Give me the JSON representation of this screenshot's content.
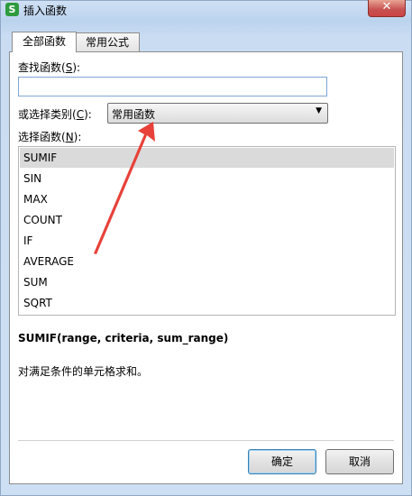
{
  "window": {
    "app_icon_letter": "S",
    "title": "插入函数",
    "close_glyph": "✕"
  },
  "tabs": [
    {
      "label": "全部函数"
    },
    {
      "label": "常用公式"
    }
  ],
  "search": {
    "label_prefix": "查找函数(",
    "label_key": "S",
    "label_suffix": "):",
    "value": "",
    "placeholder": ""
  },
  "category": {
    "label_prefix": "或选择类别(",
    "label_key": "C",
    "label_suffix": "):",
    "selected": "常用函数",
    "arrow_glyph": "▼"
  },
  "functions": {
    "label_prefix": "选择函数(",
    "label_key": "N",
    "label_suffix": "):",
    "items": [
      "SUMIF",
      "SIN",
      "MAX",
      "COUNT",
      "IF",
      "AVERAGE",
      "SUM",
      "SQRT"
    ]
  },
  "syntax": "SUMIF(range, criteria, sum_range)",
  "description": "对满足条件的单元格求和。",
  "buttons": {
    "ok": "确定",
    "cancel": "取消"
  },
  "colors": {
    "annotation_arrow": "#e8413a"
  }
}
